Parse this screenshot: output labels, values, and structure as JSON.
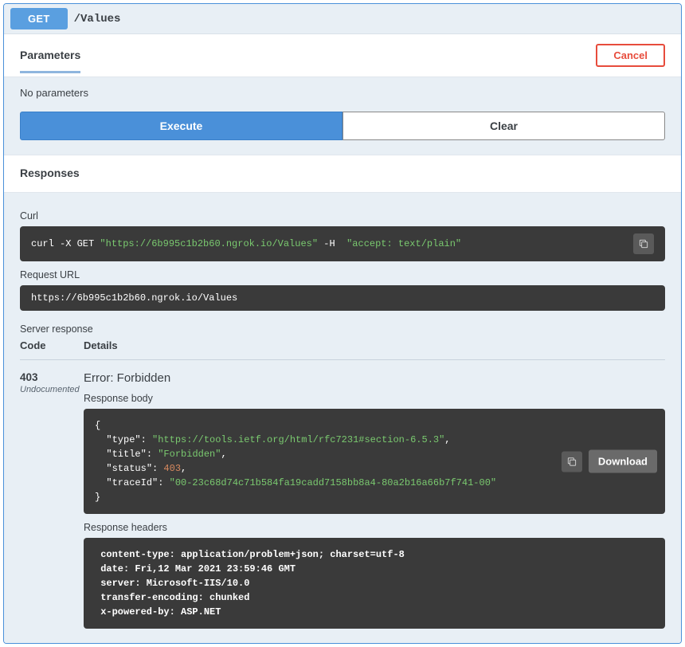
{
  "method": "GET",
  "path": "/Values",
  "parameters": {
    "title": "Parameters",
    "cancel_label": "Cancel",
    "empty_text": "No parameters",
    "execute_label": "Execute",
    "clear_label": "Clear"
  },
  "responses": {
    "title": "Responses",
    "curl_label": "Curl",
    "curl_cmd_prefix": "curl -X GET ",
    "curl_url": "\"https://6b995c1b2b60.ngrok.io/Values\"",
    "curl_h": " -H  ",
    "curl_accept": "\"accept: text/plain\"",
    "request_url_label": "Request URL",
    "request_url": "https://6b995c1b2b60.ngrok.io/Values",
    "server_response_label": "Server response",
    "code_header": "Code",
    "details_header": "Details",
    "status_code": "403",
    "undocumented": "Undocumented",
    "error_label": "Error: Forbidden",
    "response_body_label": "Response body",
    "body_json": {
      "type_key": "\"type\"",
      "type_val": "\"https://tools.ietf.org/html/rfc7231#section-6.5.3\"",
      "title_key": "\"title\"",
      "title_val": "\"Forbidden\"",
      "status_key": "\"status\"",
      "status_val": "403",
      "traceId_key": "\"traceId\"",
      "traceId_val": "\"00-23c68d74c71b584fa19cadd7158bb8a4-80a2b16a66b7f741-00\""
    },
    "download_label": "Download",
    "response_headers_label": "Response headers",
    "headers_text": " content-type: application/problem+json; charset=utf-8 \n date: Fri,12 Mar 2021 23:59:46 GMT \n server: Microsoft-IIS/10.0 \n transfer-encoding: chunked \n x-powered-by: ASP.NET "
  }
}
